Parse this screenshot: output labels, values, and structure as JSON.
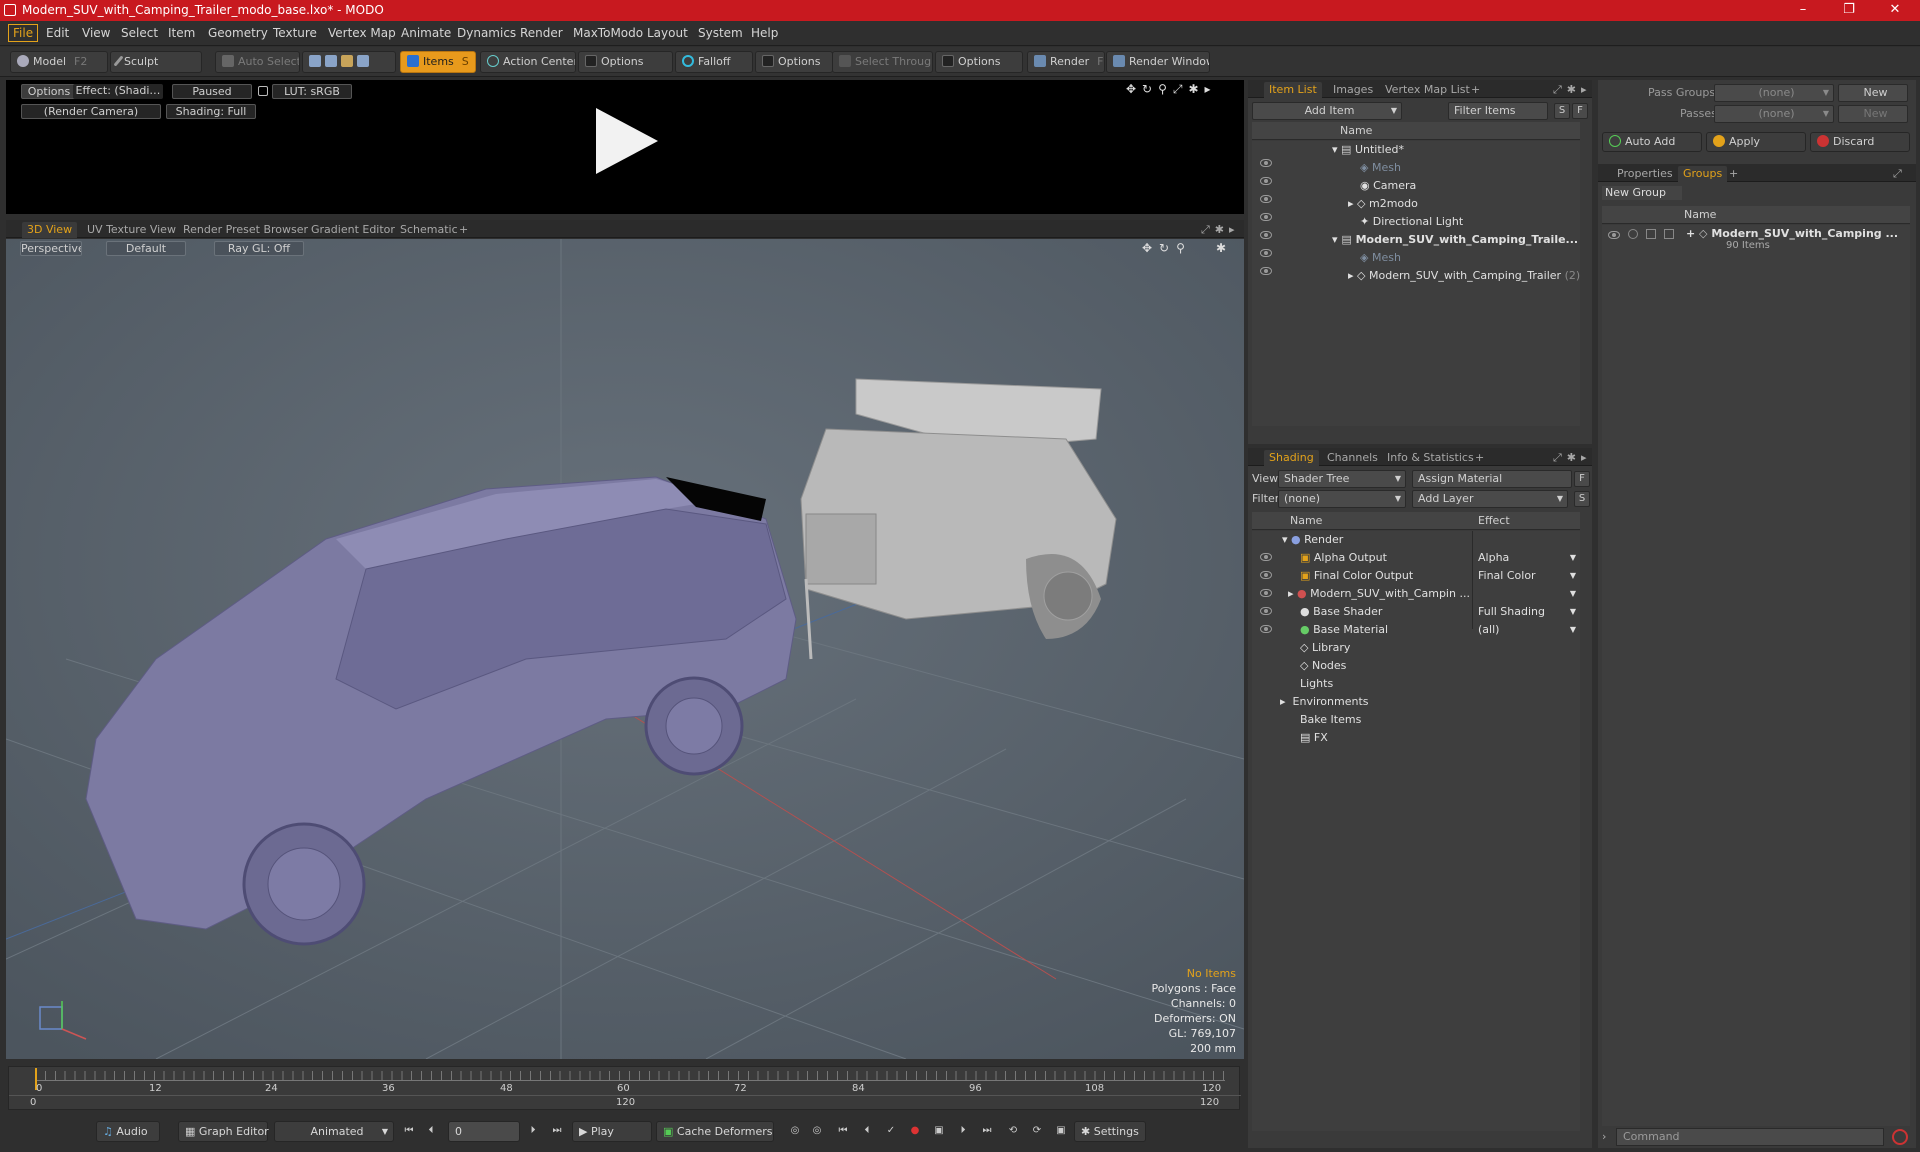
{
  "window": {
    "title": "Modern_SUV_with_Camping_Trailer_modo_base.lxo* - MODO",
    "controls": [
      "–",
      "❐",
      "✕"
    ]
  },
  "menubar": [
    "File",
    "Edit",
    "View",
    "Select",
    "Item",
    "Geometry",
    "Texture",
    "Vertex Map",
    "Animate",
    "Dynamics",
    "Render",
    "MaxToModo",
    "Layout",
    "System",
    "Help"
  ],
  "toolbar": {
    "model": "Model",
    "model_key": "F2",
    "sculpt": "Sculpt",
    "auto_select": "Auto Select",
    "items": "Items",
    "items_key": "S",
    "action_center": "Action Center",
    "options1": "Options",
    "falloff": "Falloff",
    "options2": "Options",
    "select_through": "Select Through",
    "options3": "Options",
    "render": "Render",
    "render_key": "F9",
    "render_window": "Render Window"
  },
  "preview": {
    "options": "Options",
    "effect": "Effect: (Shadi…",
    "paused": "Paused",
    "lut": "LUT: sRGB",
    "camera": "(Render Camera)",
    "shading": "Shading: Full"
  },
  "viewport_tabs": [
    "3D View",
    "UV Texture View",
    "Render Preset Browser",
    "Gradient Editor",
    "Schematic"
  ],
  "viewport": {
    "perspective": "Perspective",
    "default": "Default",
    "raygl": "Ray GL: Off",
    "stats": [
      "No Items",
      "Polygons : Face",
      "Channels: 0",
      "Deformers: ON",
      "GL: 769,107",
      "200 mm"
    ]
  },
  "item_list": {
    "tabs": [
      "Item List",
      "Images",
      "Vertex Map List"
    ],
    "add_item": "Add Item",
    "filter_items": "Filter Items",
    "s": "S",
    "f": "F",
    "col_name": "Name",
    "rows": [
      {
        "label": "Untitled*",
        "bold": false
      },
      {
        "label": "Mesh",
        "bold": false
      },
      {
        "label": "Camera",
        "bold": false
      },
      {
        "label": "m2modo",
        "bold": false
      },
      {
        "label": "Directional Light",
        "bold": false
      },
      {
        "label": "Modern_SUV_with_Camping_Traile...",
        "bold": true
      },
      {
        "label": "Mesh",
        "bold": false
      },
      {
        "label": "Modern_SUV_with_Camping_Trailer",
        "bold": false,
        "suffix": "(2)"
      }
    ]
  },
  "shading": {
    "tabs": [
      "Shading",
      "Channels",
      "Info & Statistics"
    ],
    "view_label": "View",
    "view_value": "Shader Tree",
    "assign_material": "Assign Material",
    "filter_label": "Filter",
    "filter_value": "(none)",
    "add_layer": "Add Layer",
    "f": "F",
    "s": "S",
    "col_name": "Name",
    "col_effect": "Effect",
    "rows": [
      {
        "name": "Render",
        "effect": ""
      },
      {
        "name": "Alpha Output",
        "effect": "Alpha"
      },
      {
        "name": "Final Color Output",
        "effect": "Final Color"
      },
      {
        "name": "Modern_SUV_with_Campin ...",
        "effect": ""
      },
      {
        "name": "Base Shader",
        "effect": "Full Shading"
      },
      {
        "name": "Base Material",
        "effect": "(all)"
      },
      {
        "name": "Library",
        "effect": ""
      },
      {
        "name": "Nodes",
        "effect": ""
      },
      {
        "name": "Lights",
        "effect": ""
      },
      {
        "name": "Environments",
        "effect": ""
      },
      {
        "name": "Bake Items",
        "effect": ""
      },
      {
        "name": "FX",
        "effect": ""
      }
    ]
  },
  "groups": {
    "pass_groups_label": "Pass Groups",
    "pass_groups_value": "(none)",
    "new1": "New",
    "passes_label": "Passes",
    "passes_value": "(none)",
    "new2": "New",
    "auto_add": "Auto Add",
    "apply": "Apply",
    "discard": "Discard",
    "tabs": [
      "Properties",
      "Groups"
    ],
    "new_group": "New Group",
    "col_name": "Name",
    "group_name": "Modern_SUV_with_Camping ...",
    "group_count": "90 Items"
  },
  "timeline": {
    "ticks": [
      "0",
      "12",
      "24",
      "36",
      "48",
      "60",
      "72",
      "84",
      "96",
      "108",
      "120"
    ],
    "range_start": "0",
    "range_mid": "120",
    "range_end": "120"
  },
  "bottombar": {
    "audio": "Audio",
    "graph_editor": "Graph Editor",
    "animated": "Animated",
    "frame": "0",
    "play": "Play",
    "cache_deformers": "Cache Deformers",
    "settings": "Settings",
    "command_placeholder": "Command"
  }
}
